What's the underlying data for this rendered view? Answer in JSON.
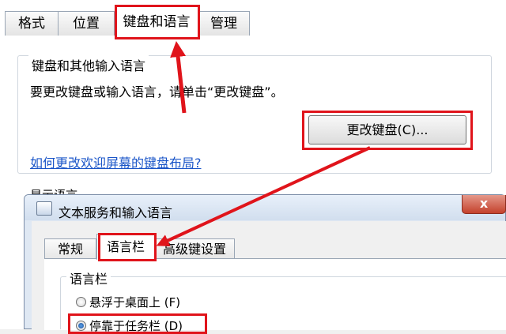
{
  "main_tabs": [
    {
      "label": "格式"
    },
    {
      "label": "位置"
    },
    {
      "label": "键盘和语言",
      "active": true
    },
    {
      "label": "管理"
    }
  ],
  "keyboard_group": {
    "title": "键盘和其他输入语言",
    "description": "要更改键盘或输入语言，请单击“更改键盘”。",
    "change_button": "更改键盘(C)...",
    "welcome_link": "如何更改欢迎屏幕的键盘布局?"
  },
  "display_language_partial": "显示语言",
  "dialog": {
    "title": "文本服务和输入语言",
    "close_glyph": "x",
    "tabs": [
      {
        "label": "常规"
      },
      {
        "label": "语言栏",
        "active": true
      },
      {
        "label": "高级键设置"
      }
    ],
    "language_bar_group": {
      "title": "语言栏",
      "options": [
        {
          "label": "悬浮于桌面上 (F)",
          "checked": false
        },
        {
          "label": "停靠于任务栏 (D)",
          "checked": true
        }
      ]
    }
  },
  "colors": {
    "highlight_red": "#e0141b",
    "link_blue": "#1a55c8"
  }
}
